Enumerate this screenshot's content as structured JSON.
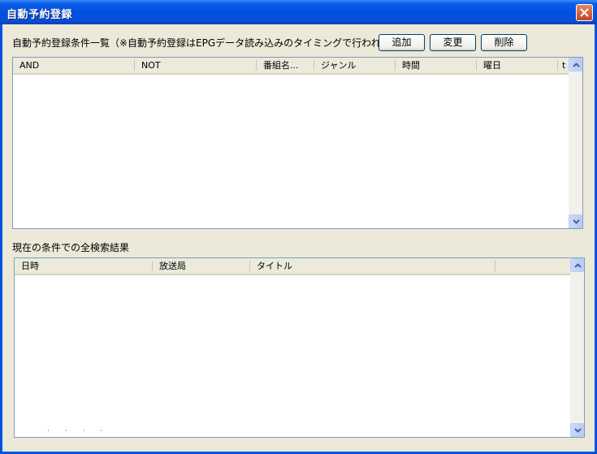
{
  "window": {
    "title": "自動予約登録"
  },
  "conditions": {
    "label": "自動予約登録条件一覧（※自動予約登録はEPGデータ読み込みのタイミングで行われます）",
    "buttons": {
      "add": "追加",
      "change": "変更",
      "delete": "削除"
    },
    "columns": [
      "AND",
      "NOT",
      "番組名...",
      "ジャンル",
      "時間",
      "曜日",
      "t"
    ]
  },
  "results": {
    "label": "現在の条件での全検索結果",
    "columns": [
      "日時",
      "放送局",
      "タイトル",
      ""
    ],
    "footer_dots": "· · · ·"
  },
  "colors": {
    "titlebar": "#0054e3",
    "window_bg": "#ece9d8",
    "close": "#c2471f"
  }
}
